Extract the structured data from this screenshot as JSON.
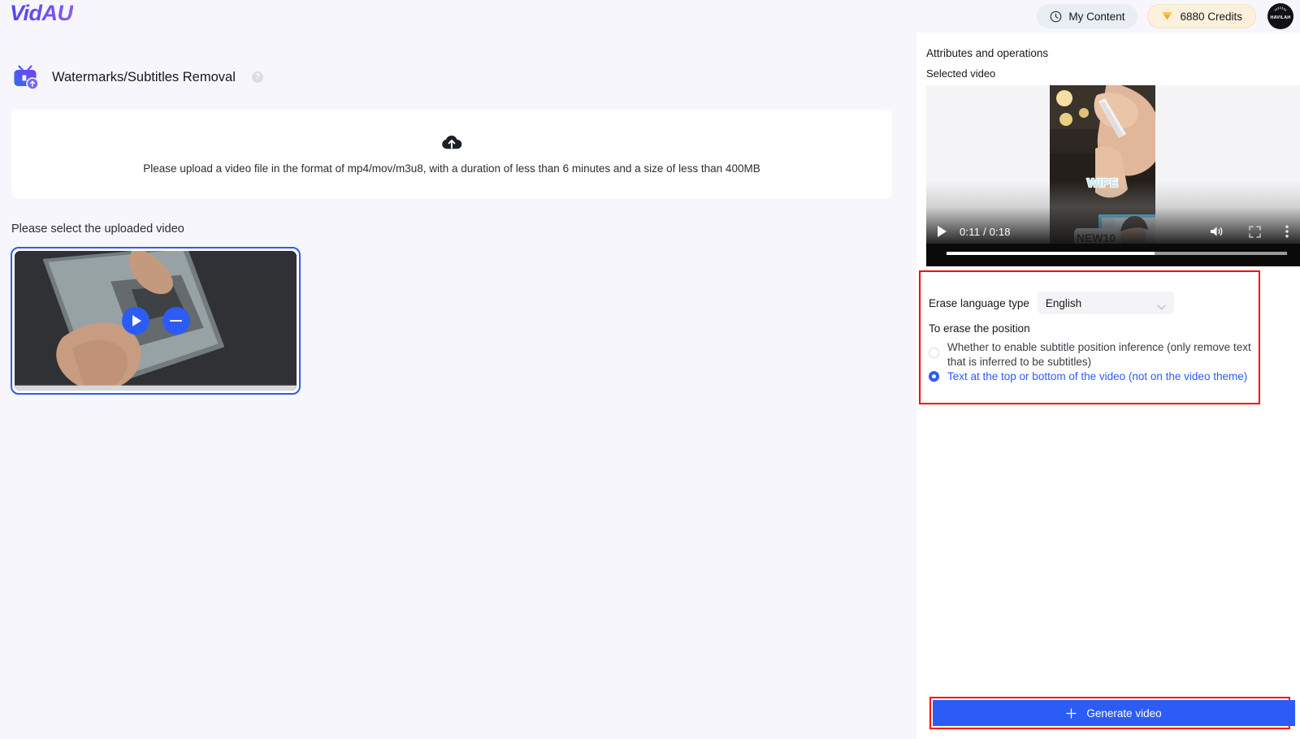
{
  "header": {
    "logo": "VidAU",
    "my_content_label": "My Content",
    "my_content_icon": "clock-icon",
    "credits_label": "6880 Credits",
    "credits_icon": "gem-icon",
    "avatar_name": "HAVILAH"
  },
  "task": {
    "title": "Watermarks/Subtitles Removal",
    "icon": "tv-upload-icon",
    "help_label": "?"
  },
  "upload": {
    "icon": "cloud-upload-icon",
    "hint": "Please upload a video file in the format of mp4/mov/m3u8, with a duration of less than 6 minutes and a size of less than 400MB"
  },
  "library": {
    "select_label": "Please select the uploaded video",
    "items": [
      {
        "selected": true,
        "play_icon": "play-icon",
        "remove_icon": "minus-icon"
      }
    ]
  },
  "panel": {
    "title": "Attributes and operations",
    "selected_video_label": "Selected video",
    "player": {
      "current_time": "0:11",
      "duration": "0:18",
      "time_display": "0:11 / 0:18",
      "progress_percent": 61,
      "play_icon": "play-icon",
      "volume_icon": "volume-icon",
      "fullscreen_icon": "fullscreen-icon",
      "more_icon": "more-vertical-icon",
      "overlay_text_1": "WIPE",
      "overlay_text_2": "NEW10"
    },
    "settings": {
      "language_label": "Erase language type",
      "language_value": "English",
      "language_chevron_icon": "chevron-down-icon",
      "position_label": "To erase the position",
      "options": [
        {
          "text": "Whether to enable subtitle position inference (only remove text that is inferred to be subtitles)",
          "selected": false
        },
        {
          "text": "Text at the top or bottom of the video (not on the video theme)",
          "selected": true
        }
      ]
    },
    "generate_button": {
      "label": "Generate video",
      "icon": "plus-icon"
    }
  },
  "colors": {
    "accent_blue": "#2c5cf5",
    "annotation_red": "#ff0000",
    "credits_amber": "#f5a623",
    "page_bg": "#f6f6fc"
  }
}
